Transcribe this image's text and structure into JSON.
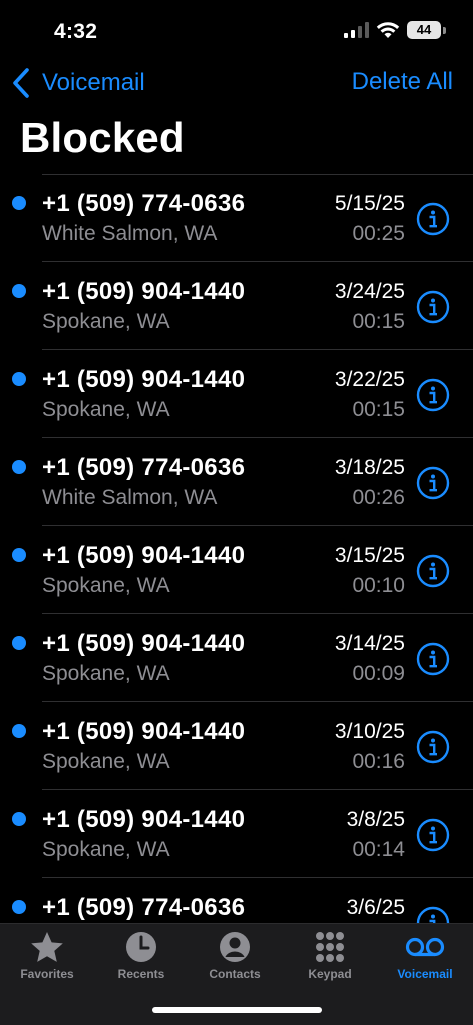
{
  "status_bar": {
    "time": "4:32",
    "battery": "44"
  },
  "nav": {
    "back_label": "Voicemail",
    "right_action": "Delete All"
  },
  "page": {
    "title": "Blocked"
  },
  "voicemails": [
    {
      "number": "+1 (509) 774-0636",
      "location": "White Salmon, WA",
      "date": "5/15/25",
      "duration": "00:25",
      "unread": true
    },
    {
      "number": "+1 (509) 904-1440",
      "location": "Spokane, WA",
      "date": "3/24/25",
      "duration": "00:15",
      "unread": true
    },
    {
      "number": "+1 (509) 904-1440",
      "location": "Spokane, WA",
      "date": "3/22/25",
      "duration": "00:15",
      "unread": true
    },
    {
      "number": "+1 (509) 774-0636",
      "location": "White Salmon, WA",
      "date": "3/18/25",
      "duration": "00:26",
      "unread": true
    },
    {
      "number": "+1 (509) 904-1440",
      "location": "Spokane, WA",
      "date": "3/15/25",
      "duration": "00:10",
      "unread": true
    },
    {
      "number": "+1 (509) 904-1440",
      "location": "Spokane, WA",
      "date": "3/14/25",
      "duration": "00:09",
      "unread": true
    },
    {
      "number": "+1 (509) 904-1440",
      "location": "Spokane, WA",
      "date": "3/10/25",
      "duration": "00:16",
      "unread": true
    },
    {
      "number": "+1 (509) 904-1440",
      "location": "Spokane, WA",
      "date": "3/8/25",
      "duration": "00:14",
      "unread": true
    },
    {
      "number": "+1 (509) 774-0636",
      "location": "",
      "date": "3/6/25",
      "duration": "",
      "unread": true
    }
  ],
  "tabs": [
    {
      "label": "Favorites",
      "icon": "star-icon",
      "active": false
    },
    {
      "label": "Recents",
      "icon": "clock-icon",
      "active": false
    },
    {
      "label": "Contacts",
      "icon": "person-icon",
      "active": false
    },
    {
      "label": "Keypad",
      "icon": "keypad-icon",
      "active": false
    },
    {
      "label": "Voicemail",
      "icon": "voicemail-icon",
      "active": true
    }
  ],
  "colors": {
    "accent": "#1a8cff",
    "secondary_text": "#8e8e93",
    "background": "#000000",
    "tabbar": "#1c1c1e"
  }
}
